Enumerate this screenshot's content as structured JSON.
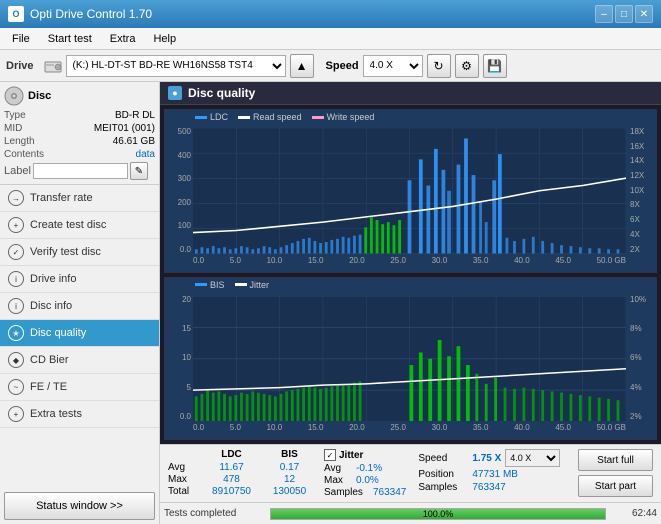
{
  "titleBar": {
    "title": "Opti Drive Control 1.70",
    "minimize": "–",
    "maximize": "□",
    "close": "✕"
  },
  "menuBar": {
    "items": [
      "File",
      "Start test",
      "Extra",
      "Help"
    ]
  },
  "toolbar": {
    "driveLabel": "Drive",
    "driveName": "(K:)  HL-DT-ST BD-RE  WH16NS58 TST4",
    "speedLabel": "Speed",
    "speedValue": "4.0 X"
  },
  "disc": {
    "label": "Disc",
    "type": {
      "key": "Type",
      "value": "BD-R DL"
    },
    "mid": {
      "key": "MID",
      "value": "MEIT01 (001)"
    },
    "length": {
      "key": "Length",
      "value": "46.61 GB"
    },
    "contents": {
      "key": "Contents",
      "value": "data"
    },
    "labelKey": "Label"
  },
  "sidebarNav": [
    {
      "id": "transfer-rate",
      "label": "Transfer rate",
      "active": false
    },
    {
      "id": "create-test-disc",
      "label": "Create test disc",
      "active": false
    },
    {
      "id": "verify-test-disc",
      "label": "Verify test disc",
      "active": false
    },
    {
      "id": "drive-info",
      "label": "Drive info",
      "active": false
    },
    {
      "id": "disc-info",
      "label": "Disc info",
      "active": false
    },
    {
      "id": "disc-quality",
      "label": "Disc quality",
      "active": true
    },
    {
      "id": "cd-bier",
      "label": "CD Bier",
      "active": false
    },
    {
      "id": "fe-te",
      "label": "FE / TE",
      "active": false
    },
    {
      "id": "extra-tests",
      "label": "Extra tests",
      "active": false
    }
  ],
  "statusWindow": "Status window >>",
  "discQuality": {
    "title": "Disc quality",
    "chart1": {
      "legend": [
        {
          "label": "LDC",
          "color": "#3399ff"
        },
        {
          "label": "Read speed",
          "color": "#ffffff"
        },
        {
          "label": "Write speed",
          "color": "#ff99cc"
        }
      ],
      "yAxis": [
        "500",
        "400",
        "300",
        "200",
        "100",
        "0.0"
      ],
      "yAxisRight": [
        "18X",
        "16X",
        "14X",
        "12X",
        "10X",
        "8X",
        "6X",
        "4X",
        "2X"
      ],
      "xAxis": [
        "0.0",
        "5.0",
        "10.0",
        "15.0",
        "20.0",
        "25.0",
        "30.0",
        "35.0",
        "40.0",
        "45.0",
        "50.0 GB"
      ]
    },
    "chart2": {
      "legend": [
        {
          "label": "BIS",
          "color": "#3399ff"
        },
        {
          "label": "Jitter",
          "color": "#ffffff"
        }
      ],
      "yAxis": [
        "20",
        "15",
        "10",
        "5",
        "0.0"
      ],
      "yAxisRight": [
        "10%",
        "8%",
        "6%",
        "4%",
        "2%"
      ],
      "xAxis": [
        "0.0",
        "5.0",
        "10.0",
        "15.0",
        "20.0",
        "25.0",
        "30.0",
        "35.0",
        "40.0",
        "45.0",
        "50.0 GB"
      ]
    }
  },
  "stats": {
    "headers": [
      "LDC",
      "BIS"
    ],
    "avg": {
      "label": "Avg",
      "ldc": "11.67",
      "bis": "0.17"
    },
    "max": {
      "label": "Max",
      "ldc": "478",
      "bis": "12"
    },
    "total": {
      "label": "Total",
      "ldc": "8910750",
      "bis": "130050"
    },
    "jitter": {
      "label": "Jitter",
      "avg": "-0.1%",
      "max": "0.0%",
      "samples": "763347"
    },
    "speed": {
      "label": "Speed",
      "value": "1.75 X",
      "selectValue": "4.0 X"
    },
    "position": {
      "label": "Position",
      "value": "47731 MB"
    },
    "samples": {
      "label": "Samples",
      "value": "763347"
    },
    "startFull": "Start full",
    "startPart": "Start part"
  },
  "statusBar": {
    "text": "Tests completed",
    "progress": "100.0%",
    "time": "62:44"
  }
}
